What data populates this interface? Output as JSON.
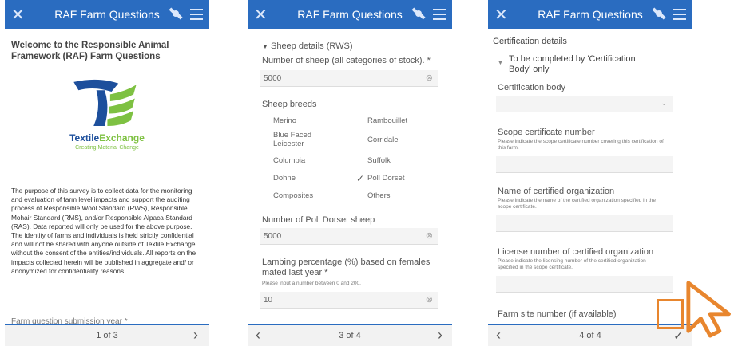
{
  "app": {
    "title": "RAF Farm Questions"
  },
  "screen1": {
    "heading": "Welcome to the Responsible Animal Framework (RAF) Farm Questions",
    "logo_name": "TextileExchange",
    "logo_name_part1": "Textile",
    "logo_name_part2": "Exchange",
    "logo_tagline": "Creating Material Change",
    "body": "The purpose of this survey is to collect data for the monitoring and evaluation of farm level impacts and support the auditing process of Responsible Wool Standard (RWS), Responsible Mohair Standard (RMS), and/or Responsible Alpaca Standard (RAS). Data reported will only be used for the above purpose. The identity of farms and individuals is held strictly confidential and will not be shared with anyone outside of Textile Exchange without the consent of the entities/individuals. All reports on the impacts collected herein will be published in aggregate and/ or anonymized for confidentiality reasons.",
    "next_question": "Farm question submission year *",
    "page": "1 of 3"
  },
  "screen2": {
    "section": "Sheep details (RWS)",
    "q_num_sheep": "Number of sheep (all categories of stock). *",
    "v_num_sheep": "5000",
    "q_breeds": "Sheep breeds",
    "breeds": [
      {
        "label": "Merino",
        "checked": false
      },
      {
        "label": "Rambouillet",
        "checked": false
      },
      {
        "label": "Blue Faced Leicester",
        "checked": false
      },
      {
        "label": "Corridale",
        "checked": false
      },
      {
        "label": "Columbia",
        "checked": false
      },
      {
        "label": "Suffolk",
        "checked": false
      },
      {
        "label": "Dohne",
        "checked": false
      },
      {
        "label": "Poll Dorset",
        "checked": true
      },
      {
        "label": "Composites",
        "checked": false
      },
      {
        "label": "Others",
        "checked": false
      }
    ],
    "q_poll": "Number of Poll Dorset sheep",
    "v_poll": "5000",
    "q_lambing": "Lambing percentage (%) based on females mated last year *",
    "hint_lambing": "Please input a number between 0 and 200.",
    "v_lambing": "10",
    "page": "3 of 4"
  },
  "screen3": {
    "section": "Certification details",
    "subsection": "To be completed by 'Certification Body' only",
    "q_body": "Certification body",
    "q_scope": "Scope certificate number",
    "hint_scope": "Please indicate the scope certificate number covering this certification of this farm.",
    "q_org": "Name of certified organization",
    "hint_org": "Please indicate the name of the certified organization specified in the scope certificate.",
    "q_license": "License number of certified organization",
    "hint_license": "Please indicate the licensing number of the certified organization specified in the scope certificate.",
    "q_farm_site": "Farm site number (if available)",
    "page": "4 of 4"
  },
  "icons": {
    "close": "x-icon",
    "satellite": "satellite-icon",
    "menu": "hamburger-menu-icon",
    "prev": "chevron-left-icon",
    "next": "chevron-right-icon",
    "submit": "checkmark-icon",
    "clear": "clear-circle-icon",
    "dropdown": "chevron-down-icon",
    "collapse": "triangle-down-icon",
    "cursor": "pointer-cursor-icon"
  },
  "colors": {
    "header": "#2a6cc0",
    "logo_blue": "#1d4f9c",
    "logo_green": "#7ec142",
    "cursor_orange": "#e8862e"
  }
}
